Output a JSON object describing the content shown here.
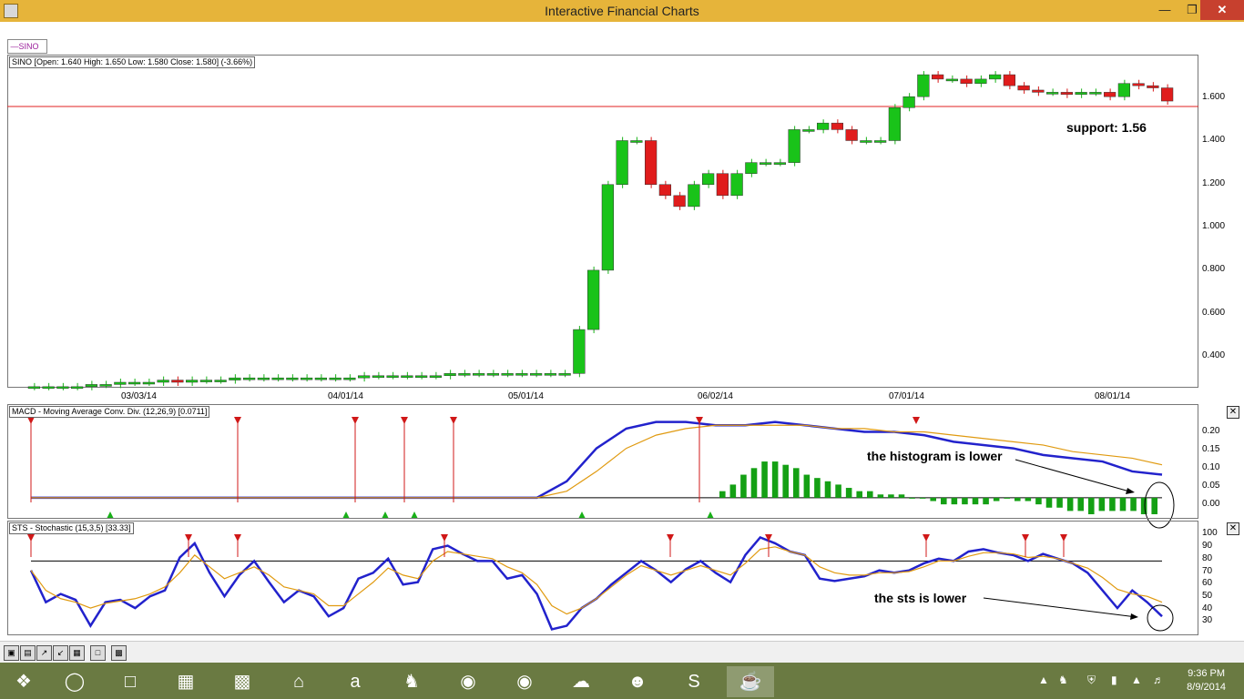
{
  "window": {
    "title": "Interactive Financial Charts",
    "minimize": "—",
    "maximize": "❐",
    "close": "✕"
  },
  "legend_chip": "SINO",
  "price_panel": {
    "label": "SINO [Open: 1.640  High: 1.650  Low: 1.580  Close: 1.580] (-3.66%)",
    "support_label": "support: 1.56",
    "y_ticks": [
      "1.600",
      "1.400",
      "1.200",
      "1.000",
      "0.800",
      "0.600",
      "0.400"
    ],
    "x_ticks": [
      "03/03/14",
      "04/01/14",
      "05/01/14",
      "06/02/14",
      "07/01/14",
      "08/01/14"
    ]
  },
  "macd_panel": {
    "label": "MACD - Moving Average Conv. Div. (12,26,9) [0.0711]",
    "y_ticks": [
      "0.20",
      "0.15",
      "0.10",
      "0.05",
      "0.00"
    ],
    "annotation": "the histogram is lower"
  },
  "sts_panel": {
    "label": "STS - Stochastic (15,3,5) [33.33]",
    "y_ticks": [
      "100",
      "90",
      "80",
      "70",
      "60",
      "50",
      "40",
      "30"
    ],
    "annotation": "the sts is lower"
  },
  "chart_data": [
    {
      "type": "line",
      "title": "SINO",
      "ylim": [
        0.3,
        1.75
      ],
      "support_level": 1.56,
      "series": [
        {
          "values": [
            0.28,
            0.28,
            0.28,
            0.28,
            0.29,
            0.29,
            0.3,
            0.3,
            0.3,
            0.31,
            0.3,
            0.31,
            0.31,
            0.31,
            0.32,
            0.32,
            0.32,
            0.32,
            0.32,
            0.32,
            0.32,
            0.32,
            0.32,
            0.33,
            0.33,
            0.33,
            0.33,
            0.33,
            0.33,
            0.34,
            0.34,
            0.34,
            0.34,
            0.34,
            0.34,
            0.34,
            0.34,
            0.34,
            0.54,
            0.81,
            1.2,
            1.4,
            1.4,
            1.2,
            1.15,
            1.1,
            1.2,
            1.25,
            1.15,
            1.25,
            1.3,
            1.3,
            1.3,
            1.45,
            1.45,
            1.48,
            1.45,
            1.4,
            1.4,
            1.4,
            1.55,
            1.6,
            1.7,
            1.68,
            1.68,
            1.66,
            1.68,
            1.7,
            1.65,
            1.63,
            1.62,
            1.62,
            1.61,
            1.62,
            1.62,
            1.6,
            1.66,
            1.65,
            1.64,
            1.58
          ]
        }
      ]
    },
    {
      "type": "line",
      "title": "MACD",
      "ylim": [
        -0.05,
        0.24
      ],
      "series": [
        {
          "values": [
            0.0,
            0.0,
            0.0,
            0.0,
            0.0,
            0.0,
            0.0,
            0.0,
            0.0,
            0.0,
            0.0,
            0.0,
            0.0,
            0.0,
            0.0,
            0.0,
            0.0,
            0.0,
            0.05,
            0.15,
            0.21,
            0.23,
            0.23,
            0.22,
            0.22,
            0.23,
            0.22,
            0.21,
            0.2,
            0.2,
            0.19,
            0.17,
            0.16,
            0.15,
            0.13,
            0.12,
            0.11,
            0.08,
            0.07
          ]
        },
        {
          "values": [
            0.0,
            0.0,
            0.0,
            0.0,
            0.0,
            0.0,
            0.0,
            0.0,
            0.0,
            0.0,
            0.0,
            0.0,
            0.0,
            0.0,
            0.0,
            0.0,
            0.0,
            0.0,
            0.02,
            0.08,
            0.15,
            0.19,
            0.21,
            0.22,
            0.22,
            0.22,
            0.22,
            0.21,
            0.21,
            0.2,
            0.2,
            0.19,
            0.18,
            0.17,
            0.16,
            0.14,
            0.13,
            0.12,
            0.1
          ]
        }
      ],
      "histogram": [
        0.02,
        0.04,
        0.07,
        0.09,
        0.11,
        0.11,
        0.1,
        0.09,
        0.07,
        0.06,
        0.05,
        0.04,
        0.03,
        0.02,
        0.02,
        0.01,
        0.01,
        0.01,
        0.0,
        0.0,
        -0.01,
        -0.02,
        -0.02,
        -0.02,
        -0.02,
        -0.02,
        -0.01,
        0.0,
        -0.01,
        -0.01,
        -0.02,
        -0.03,
        -0.03,
        -0.04,
        -0.04,
        -0.05,
        -0.04,
        -0.04,
        -0.04,
        -0.04,
        -0.05,
        -0.05
      ]
    },
    {
      "type": "line",
      "title": "STS - Stochastic (15,3,5)",
      "ylim": [
        20,
        105
      ],
      "series": [
        {
          "values": [
            72,
            45,
            52,
            47,
            25,
            45,
            47,
            40,
            50,
            55,
            83,
            95,
            70,
            50,
            68,
            80,
            62,
            45,
            55,
            50,
            33,
            40,
            65,
            70,
            82,
            60,
            62,
            90,
            93,
            86,
            80,
            80,
            65,
            68,
            52,
            22,
            25,
            40,
            48,
            60,
            70,
            80,
            72,
            62,
            73,
            80,
            70,
            62,
            85,
            100,
            95,
            88,
            85,
            65,
            63,
            65,
            67,
            72,
            70,
            72,
            78,
            82,
            80,
            88,
            90,
            87,
            85,
            80,
            86,
            82,
            78,
            70,
            55,
            40,
            55,
            45,
            33
          ]
        },
        {
          "values": [
            72,
            55,
            48,
            45,
            40,
            44,
            46,
            48,
            52,
            58,
            70,
            85,
            75,
            65,
            70,
            75,
            68,
            58,
            55,
            52,
            42,
            42,
            52,
            62,
            74,
            68,
            65,
            80,
            88,
            86,
            84,
            82,
            75,
            70,
            60,
            42,
            35,
            40,
            48,
            58,
            68,
            76,
            72,
            68,
            72,
            76,
            72,
            68,
            78,
            90,
            92,
            88,
            85,
            75,
            70,
            68,
            68,
            70,
            70,
            71,
            75,
            80,
            80,
            84,
            87,
            87,
            86,
            83,
            84,
            82,
            78,
            74,
            66,
            56,
            52,
            50,
            45
          ]
        }
      ],
      "overbought_line": 80
    }
  ],
  "taskbar": {
    "time": "9:36 PM",
    "date": "8/9/2014"
  }
}
